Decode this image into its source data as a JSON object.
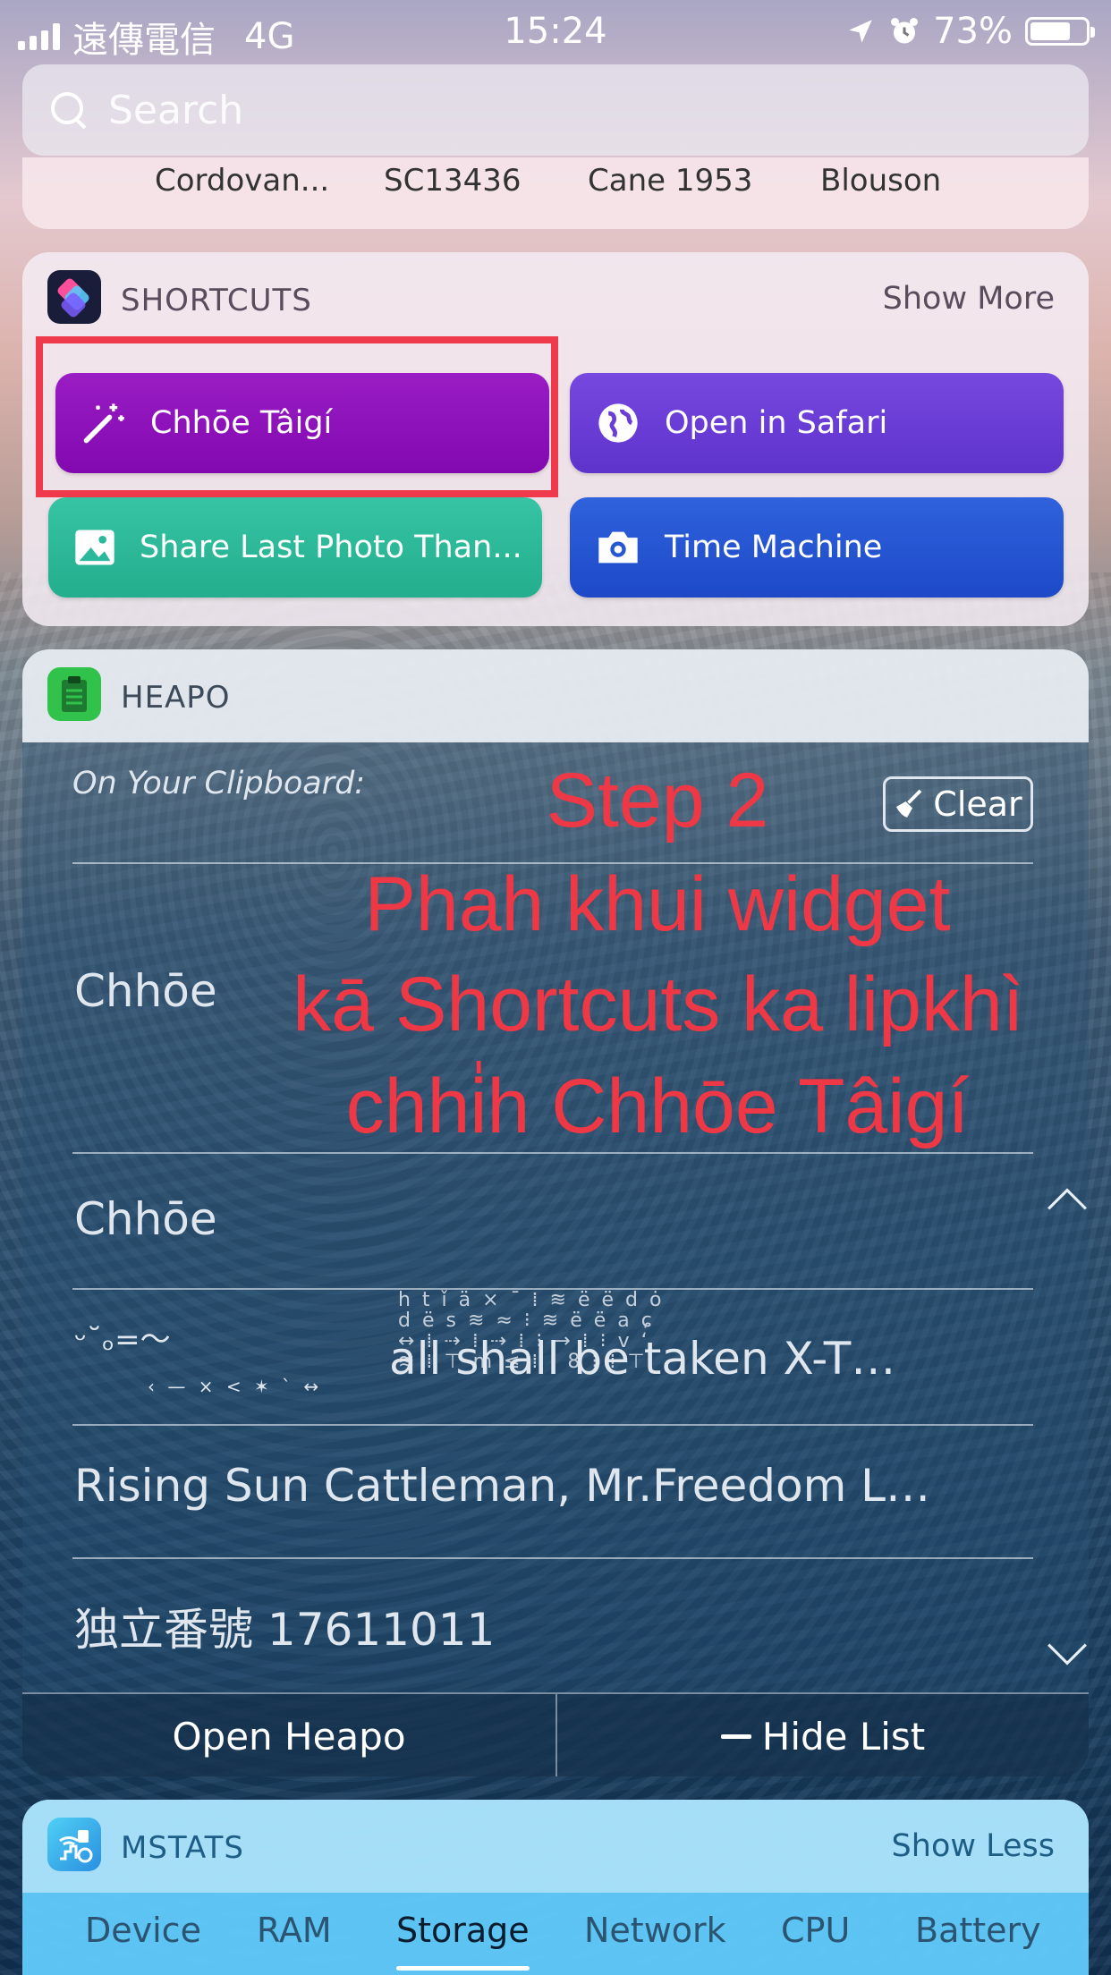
{
  "status_bar": {
    "carrier": "遠傳電信",
    "network": "4G",
    "time": "15:24",
    "battery": "73%",
    "battery_level": 0.73
  },
  "search": {
    "placeholder": "Search"
  },
  "previous_widget": {
    "items": [
      "Cordovan...",
      "SC13436",
      "Cane 1953",
      "Blouson"
    ]
  },
  "shortcuts": {
    "title": "SHORTCUTS",
    "show_more": "Show More",
    "buttons": [
      {
        "label": "Chhōe Tâigí",
        "icon": "magic-wand-icon",
        "color": "#8a0eb8"
      },
      {
        "label": "Open in Safari",
        "icon": "globe-icon",
        "color": "#6a3ed6"
      },
      {
        "label": "Share Last Photo Than...",
        "icon": "photo-icon",
        "color": "#2cb89a"
      },
      {
        "label": "Time Machine",
        "icon": "camera-icon",
        "color": "#2457d4"
      }
    ]
  },
  "heapo": {
    "title": "HEAPO",
    "clipboard_label": "On Your Clipboard:",
    "clear_label": "Clear",
    "clipboard_text": "Chhōe",
    "history": [
      "Chhōe",
      "all shall be taken  X-T…",
      "Rising Sun Cattleman, Mr.Freedom L…",
      "独立番號 17611011"
    ],
    "emoticon": "ᵕ˘ₒ=〜",
    "open_label": "Open Heapo",
    "hide_label": "Hide List"
  },
  "overlay": {
    "line1": "Step 2",
    "line2": "Phah khui widget",
    "line3": "kā Shortcuts ka lipkhì",
    "line4": "chhi̍h Chhōe Tâigí"
  },
  "mstats": {
    "title": "MSTATS",
    "show_less": "Show Less",
    "tabs": [
      "Device",
      "RAM",
      "Storage",
      "Network",
      "CPU",
      "Battery"
    ],
    "active_tab": "Storage"
  },
  "colors": {
    "highlight": "#ee3a4a",
    "overlay_text": "#ef3845"
  }
}
